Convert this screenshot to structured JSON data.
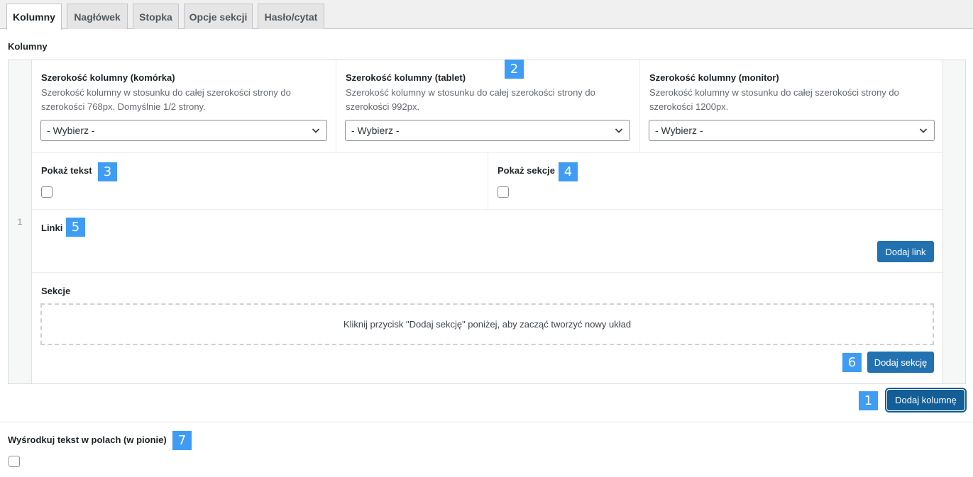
{
  "tabs": [
    {
      "label": "Kolumny",
      "active": true
    },
    {
      "label": "Nagłówek",
      "active": false
    },
    {
      "label": "Stopka",
      "active": false
    },
    {
      "label": "Opcje sekcji",
      "active": false
    },
    {
      "label": "Hasło/cytat",
      "active": false
    }
  ],
  "columns_label": "Kolumny",
  "row": {
    "index": "1",
    "width_mobile": {
      "title": "Szerokość kolumny (komórka)",
      "desc_line1": "Szerokość kolumny w stosunku do całej szerokości strony do",
      "desc_line2": "szerokości 768px. Domyślnie 1/2 strony.",
      "value": "- Wybierz -"
    },
    "width_tablet": {
      "title": "Szerokość kolumny (tablet)",
      "desc_line1": "Szerokość kolumny w stosunku do całej szerokości strony do",
      "desc_line2": "szerokości 992px.",
      "value": "- Wybierz -"
    },
    "width_monitor": {
      "title": "Szerokość kolumny (monitor)",
      "desc_line1": "Szerokość kolumny w stosunku do całej szerokości strony do",
      "desc_line2": "szerokości 1200px.",
      "value": "- Wybierz -"
    },
    "show_text": {
      "label": "Pokaż tekst",
      "checked": false
    },
    "show_sections": {
      "label": "Pokaż sekcje",
      "checked": false
    },
    "links": {
      "label": "Linki",
      "add_button": "Dodaj link"
    },
    "sections": {
      "label": "Sekcje",
      "empty_message": "Kliknij przycisk \"Dodaj sekcję\" poniżej, aby zacząć tworzyć nowy układ",
      "add_button": "Dodaj sekcję"
    }
  },
  "add_column_button": "Dodaj kolumnę",
  "center_text": {
    "label": "Wyśrodkuj tekst w polach (w pionie)",
    "checked": false
  },
  "markers": [
    "1",
    "2",
    "3",
    "4",
    "5",
    "6",
    "7"
  ],
  "colors": {
    "accent": "#2271b1",
    "marker": "#3f9cf3"
  }
}
